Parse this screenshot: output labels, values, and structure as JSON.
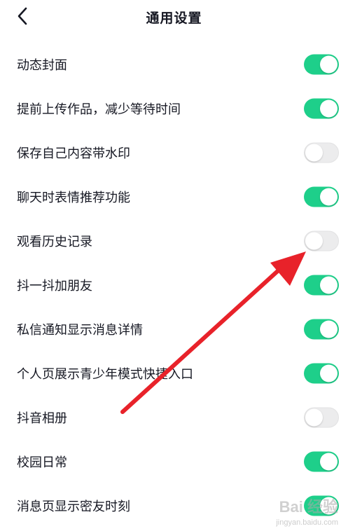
{
  "header": {
    "title": "通用设置",
    "back_icon": "chevron-left-icon"
  },
  "settings": [
    {
      "label": "动态封面",
      "on": true
    },
    {
      "label": "提前上传作品，减少等待时间",
      "on": true
    },
    {
      "label": "保存自己内容带水印",
      "on": false
    },
    {
      "label": "聊天时表情推荐功能",
      "on": true
    },
    {
      "label": "观看历史记录",
      "on": false
    },
    {
      "label": "抖一抖加朋友",
      "on": true
    },
    {
      "label": "私信通知显示消息详情",
      "on": true
    },
    {
      "label": "个人页展示青少年模式快捷入口",
      "on": true
    },
    {
      "label": "抖音相册",
      "on": false
    },
    {
      "label": "校园日常",
      "on": true
    },
    {
      "label": "消息页显示密友时刻",
      "on": true
    }
  ],
  "colors": {
    "toggle_on": "#1ecf8a",
    "toggle_off": "#ececed",
    "annotation_arrow": "#e8222a"
  },
  "watermark": {
    "main": "Bai 经验",
    "sub": "jingyan.baidu.com"
  }
}
